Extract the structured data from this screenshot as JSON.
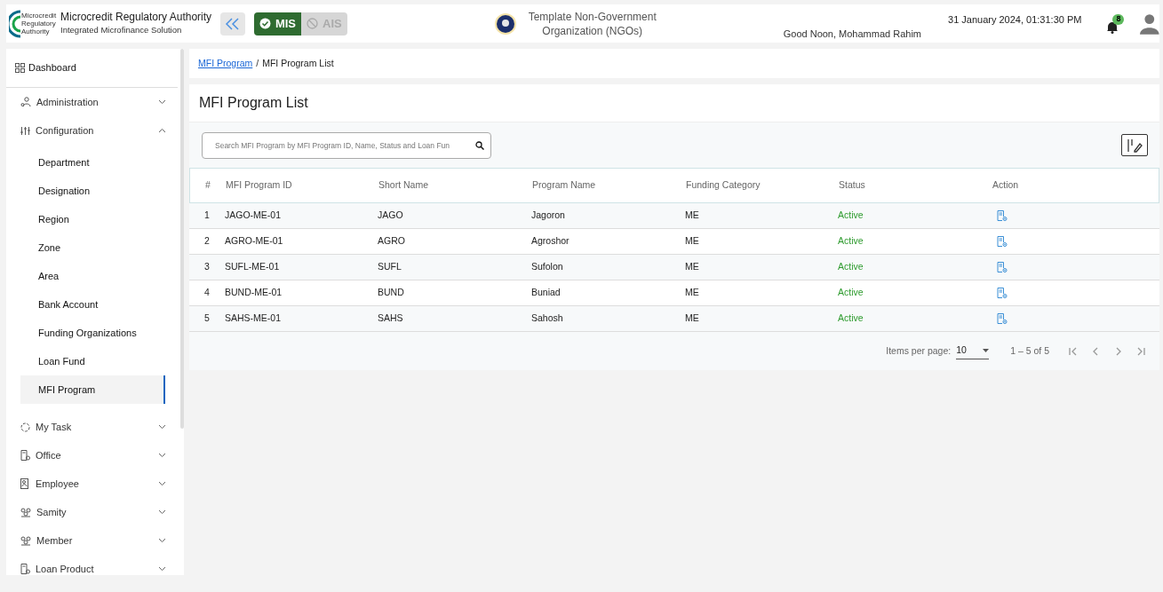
{
  "header": {
    "logo_text": "Microcredit Regulatory Authority",
    "org_name": "Microcredit Regulatory Authority",
    "org_subtitle": "Integrated Microfinance Solution",
    "modules": [
      {
        "label": "MIS",
        "selected": true
      },
      {
        "label": "AIS",
        "selected": false
      }
    ],
    "tenant": "Template Non-Government Organization (NGOs)",
    "greeting": "Good Noon, Mohammad Rahim",
    "datetime": "31 January 2024, 01:31:30 PM",
    "notification_count": "8"
  },
  "sidebar": {
    "items": [
      {
        "label": "Dashboard",
        "kind": "link"
      },
      {
        "label": "Administration",
        "kind": "group",
        "expanded": false
      },
      {
        "label": "Configuration",
        "kind": "group",
        "expanded": true,
        "children": [
          {
            "label": "Department",
            "selected": false
          },
          {
            "label": "Designation",
            "selected": false
          },
          {
            "label": "Region",
            "selected": false
          },
          {
            "label": "Zone",
            "selected": false
          },
          {
            "label": "Area",
            "selected": false
          },
          {
            "label": "Bank Account",
            "selected": false
          },
          {
            "label": "Funding Organizations",
            "selected": false
          },
          {
            "label": "Loan Fund",
            "selected": false
          },
          {
            "label": "MFI Program",
            "selected": true
          }
        ]
      },
      {
        "label": "My Task",
        "kind": "group",
        "expanded": false
      },
      {
        "label": "Office",
        "kind": "group",
        "expanded": false
      },
      {
        "label": "Employee",
        "kind": "group",
        "expanded": false
      },
      {
        "label": "Samity",
        "kind": "group",
        "expanded": false
      },
      {
        "label": "Member",
        "kind": "group",
        "expanded": false
      },
      {
        "label": "Loan Product",
        "kind": "group",
        "expanded": false
      }
    ]
  },
  "breadcrumb": {
    "separator": "/",
    "items": [
      {
        "label": "MFI Program",
        "link": true
      },
      {
        "label": "MFI Program List",
        "link": false
      }
    ]
  },
  "page_title": "MFI Program List",
  "search": {
    "placeholder": "Search MFI Program by MFI Program ID, Name, Status and Loan Fun"
  },
  "table": {
    "columns": [
      "#",
      "MFI Program ID",
      "Short Name",
      "Program Name",
      "Funding Category",
      "Status",
      "Action"
    ],
    "rows": [
      {
        "index": "1",
        "id": "JAGO-ME-01",
        "short": "JAGO",
        "name": "Jagoron",
        "category": "ME",
        "status": "Active"
      },
      {
        "index": "2",
        "id": "AGRO-ME-01",
        "short": "AGRO",
        "name": "Agroshor",
        "category": "ME",
        "status": "Active"
      },
      {
        "index": "3",
        "id": "SUFL-ME-01",
        "short": "SUFL",
        "name": "Sufolon",
        "category": "ME",
        "status": "Active"
      },
      {
        "index": "4",
        "id": "BUND-ME-01",
        "short": "BUND",
        "name": "Buniad",
        "category": "ME",
        "status": "Active"
      },
      {
        "index": "5",
        "id": "SAHS-ME-01",
        "short": "SAHS",
        "name": "Sahosh",
        "category": "ME",
        "status": "Active"
      }
    ]
  },
  "paginator": {
    "label": "Items per page:",
    "page_size": "10",
    "range": "1 – 5 of 5"
  }
}
